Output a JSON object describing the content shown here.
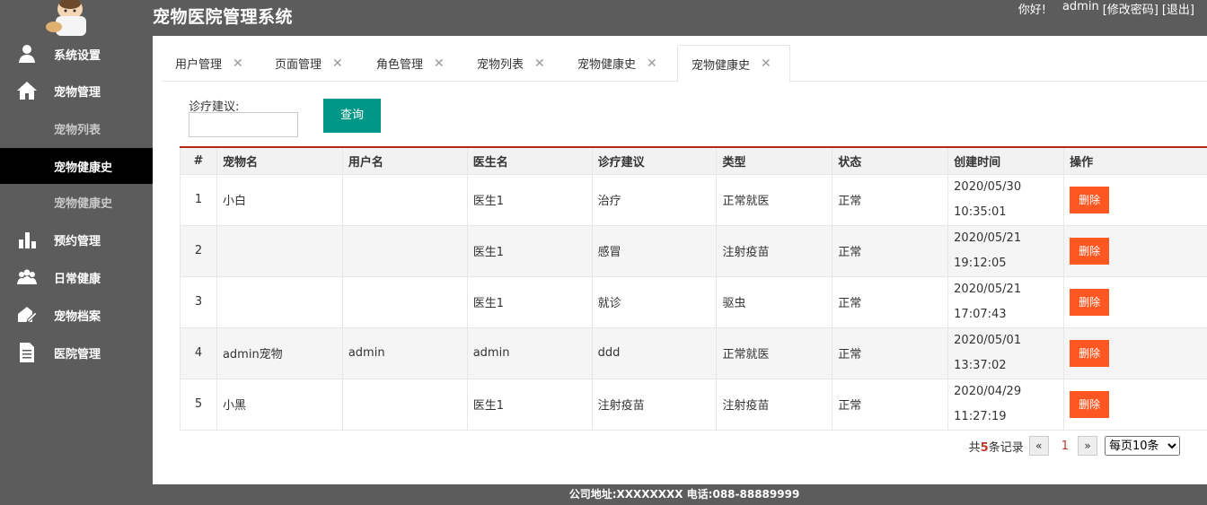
{
  "header": {
    "title": "宠物医院管理系统",
    "greeting": "你好!",
    "username": "admin",
    "change_password": "[修改密码]",
    "logout": "[退出]"
  },
  "sidebar": {
    "items": [
      {
        "label": "系统设置",
        "icon": "user-icon"
      },
      {
        "label": "宠物管理",
        "icon": "home-icon"
      },
      {
        "label": "宠物列表",
        "icon": ""
      },
      {
        "label": "宠物健康史",
        "icon": ""
      },
      {
        "label": "宠物健康史",
        "icon": ""
      },
      {
        "label": "预约管理",
        "icon": "bar-chart-icon"
      },
      {
        "label": "日常健康",
        "icon": "users-icon"
      },
      {
        "label": "宠物档案",
        "icon": "edit-icon"
      },
      {
        "label": "医院管理",
        "icon": "document-icon"
      }
    ]
  },
  "tabs": [
    {
      "label": "用户管理"
    },
    {
      "label": "页面管理"
    },
    {
      "label": "角色管理"
    },
    {
      "label": "宠物列表"
    },
    {
      "label": "宠物健康史"
    },
    {
      "label": "宠物健康史"
    }
  ],
  "search": {
    "label": "诊疗建议:",
    "value": "",
    "button": "查询"
  },
  "table": {
    "headers": [
      "#",
      "宠物名",
      "用户名",
      "医生名",
      "诊疗建议",
      "类型",
      "状态",
      "创建时间",
      "操作"
    ],
    "rows": [
      {
        "num": "1",
        "pet": "小白",
        "user": "",
        "doctor": "医生1",
        "advice": "治疗",
        "type": "正常就医",
        "status": "正常",
        "date": "2020/05/30",
        "time": "10:35:01",
        "action": "删除"
      },
      {
        "num": "2",
        "pet": "",
        "user": "",
        "doctor": "医生1",
        "advice": "感冒",
        "type": "注射疫苗",
        "status": "正常",
        "date": "2020/05/21",
        "time": "19:12:05",
        "action": "删除"
      },
      {
        "num": "3",
        "pet": "",
        "user": "",
        "doctor": "医生1",
        "advice": "就诊",
        "type": "驱虫",
        "status": "正常",
        "date": "2020/05/21",
        "time": "17:07:43",
        "action": "删除"
      },
      {
        "num": "4",
        "pet": "admin宠物",
        "user": "admin",
        "doctor": "admin",
        "advice": "ddd",
        "type": "正常就医",
        "status": "正常",
        "date": "2020/05/01",
        "time": "13:37:02",
        "action": "删除"
      },
      {
        "num": "5",
        "pet": "小黑",
        "user": "",
        "doctor": "医生1",
        "advice": "注射疫苗",
        "type": "注射疫苗",
        "status": "正常",
        "date": "2020/04/29",
        "time": "11:27:19",
        "action": "删除"
      }
    ]
  },
  "pager": {
    "prefix": "共",
    "count": "5",
    "suffix": "条记录",
    "prev": "«",
    "current": "1",
    "next": "»",
    "page_size": "每页10条"
  },
  "footer": {
    "text": "公司地址:XXXXXXXX 电话:088-88889999"
  }
}
